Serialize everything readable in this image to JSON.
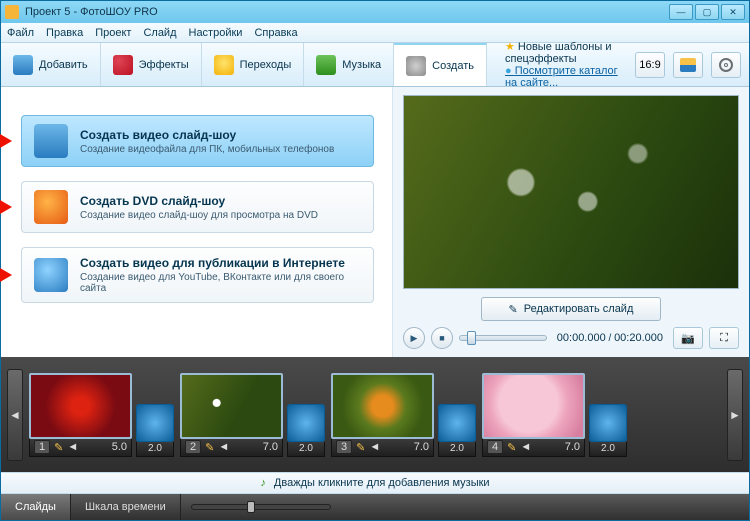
{
  "window": {
    "title": "Проект 5 - ФотоШОУ PRO"
  },
  "menu": {
    "items": [
      "Файл",
      "Правка",
      "Проект",
      "Слайд",
      "Настройки",
      "Справка"
    ]
  },
  "tabs": {
    "add": "Добавить",
    "effects": "Эффекты",
    "transitions": "Переходы",
    "music": "Музыка",
    "create": "Создать"
  },
  "promo": {
    "line1": "Новые шаблоны и спецэффекты",
    "line2": "Посмотрите каталог на сайте..."
  },
  "aspect": {
    "label": "16:9"
  },
  "options": {
    "o1": {
      "title": "Создать видео слайд-шоу",
      "desc": "Создание видеофайла для ПК, мобильных телефонов"
    },
    "o2": {
      "title": "Создать DVD слайд-шоу",
      "desc": "Создание видео слайд-шоу для просмотра на DVD"
    },
    "o3": {
      "title": "Создать видео для публикации в Интернете",
      "desc": "Создание видео для YouTube, ВКонтакте или для своего сайта"
    }
  },
  "preview": {
    "edit": "Редактировать слайд",
    "time_current": "00:00.000",
    "time_total": "00:20.000"
  },
  "timeline": {
    "slides": [
      {
        "n": "1",
        "dur": "5.0",
        "trans": "2.0"
      },
      {
        "n": "2",
        "dur": "7.0",
        "trans": "2.0"
      },
      {
        "n": "3",
        "dur": "7.0",
        "trans": "2.0"
      },
      {
        "n": "4",
        "dur": "7.0",
        "trans": "2.0"
      }
    ]
  },
  "musicbar": {
    "text": "Дважды кликните для добавления музыки"
  },
  "bottom": {
    "tab_slides": "Слайды",
    "tab_scale": "Шкала времени"
  }
}
